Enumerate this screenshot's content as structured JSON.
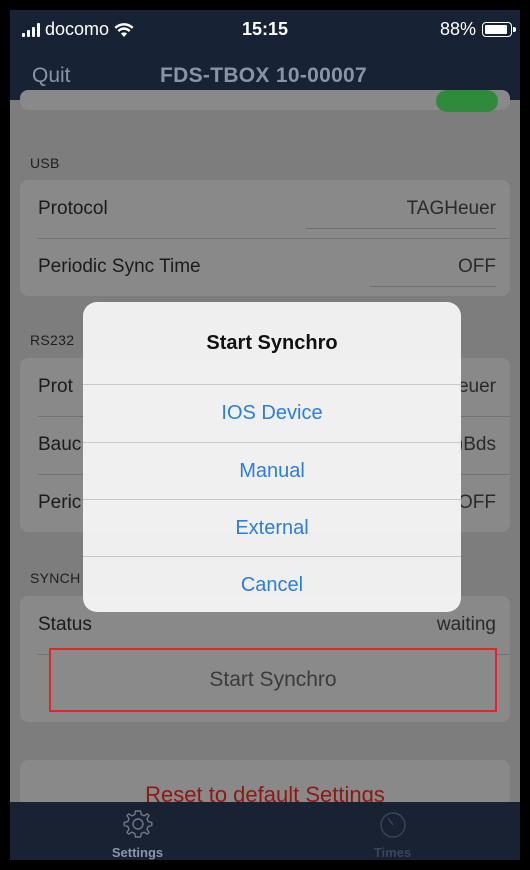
{
  "status_bar": {
    "carrier": "docomo",
    "time": "15:15",
    "battery": "88%"
  },
  "nav": {
    "back_label": "Quit",
    "title": "FDS-TBOX 10-00007"
  },
  "usb": {
    "section_label": "USB",
    "rows": [
      {
        "label": "Protocol",
        "value": "TAGHeuer"
      },
      {
        "label": "Periodic Sync Time",
        "value": "OFF"
      }
    ]
  },
  "rs232": {
    "section_label": "RS232",
    "rows": [
      {
        "label": "Prot",
        "value": "euer"
      },
      {
        "label": "Bauc",
        "value": ")Bds"
      },
      {
        "label": "Peric",
        "value": "OFF"
      }
    ]
  },
  "synchro": {
    "section_label": "SYNCH",
    "status_label": "Status",
    "status_value": "waiting",
    "start_button": "Start Synchro"
  },
  "reset_button": "Reset to default Settings",
  "tabs": [
    {
      "label": "Settings",
      "icon": "gear-icon",
      "active": true
    },
    {
      "label": "Times",
      "icon": "stopwatch-icon",
      "active": false
    }
  ],
  "alert": {
    "title": "Start Synchro",
    "options": [
      "IOS Device",
      "Manual",
      "External",
      "Cancel"
    ]
  },
  "colors": {
    "bar_bg": "#172234",
    "accent_blue": "#2b7de0",
    "destructive_red": "#8e1812",
    "highlight_border": "#e0262b",
    "toggle_green": "#2f8a3c"
  }
}
